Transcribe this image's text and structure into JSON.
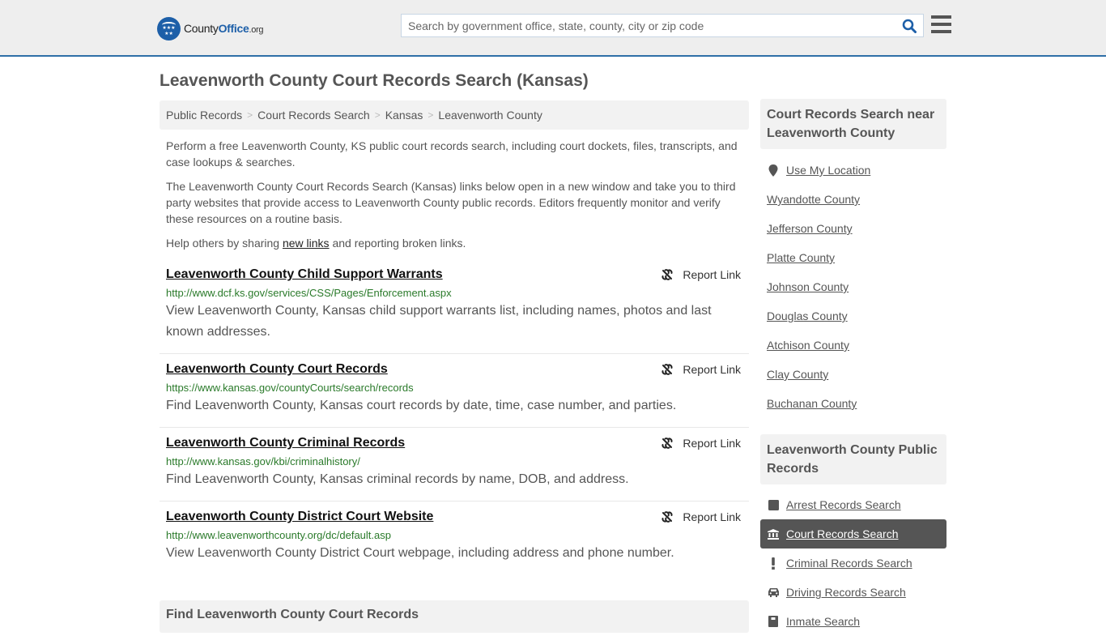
{
  "header": {
    "logo": {
      "county": "County",
      "office": "Office",
      "org": ".org"
    },
    "search": {
      "placeholder": "Search by government office, state, county, city or zip code",
      "value": ""
    },
    "icons": {
      "search": "search-icon",
      "menu": "hamburger-menu-icon"
    }
  },
  "page": {
    "title": "Leavenworth County Court Records Search (Kansas)"
  },
  "breadcrumb": [
    {
      "label": "Public Records"
    },
    {
      "label": "Court Records Search"
    },
    {
      "label": "Kansas"
    },
    {
      "label": "Leavenworth County"
    }
  ],
  "intro": {
    "p1": "Perform a free Leavenworth County, KS public court records search, including court dockets, files, transcripts, and case lookups & searches.",
    "p2": "The Leavenworth County Court Records Search (Kansas) links below open in a new window and take you to third party websites that provide access to Leavenworth County public records. Editors frequently monitor and verify these resources on a routine basis.",
    "p3_before": "Help others by sharing ",
    "p3_link": "new links",
    "p3_after": " and reporting broken links."
  },
  "links": [
    {
      "title": "Leavenworth County Child Support Warrants",
      "url": "http://www.dcf.ks.gov/services/CSS/Pages/Enforcement.aspx",
      "description": "View Leavenworth County, Kansas child support warrants list, including names, photos and last known addresses.",
      "report_label": "Report Link"
    },
    {
      "title": "Leavenworth County Court Records",
      "url": "https://www.kansas.gov/countyCourts/search/records",
      "description": "Find Leavenworth County, Kansas court records by date, time, case number, and parties.",
      "report_label": "Report Link"
    },
    {
      "title": "Leavenworth County Criminal Records",
      "url": "http://www.kansas.gov/kbi/criminalhistory/",
      "description": "Find Leavenworth County, Kansas criminal records by name, DOB, and address.",
      "report_label": "Report Link"
    },
    {
      "title": "Leavenworth County District Court Website",
      "url": "http://www.leavenworthcounty.org/dc/default.asp",
      "description": "View Leavenworth County District Court webpage, including address and phone number.",
      "report_label": "Report Link"
    }
  ],
  "find_section": {
    "title": "Find Leavenworth County Court Records"
  },
  "sidebar": {
    "nearby": {
      "title": "Court Records Search near Leavenworth County",
      "use_location": "Use My Location",
      "counties": [
        "Wyandotte County",
        "Jefferson County",
        "Platte County",
        "Johnson County",
        "Douglas County",
        "Atchison County",
        "Clay County",
        "Buchanan County"
      ]
    },
    "public_records": {
      "title": "Leavenworth County Public Records",
      "items": [
        {
          "label": "Arrest Records Search",
          "icon": "square-icon",
          "active": false
        },
        {
          "label": "Court Records Search",
          "icon": "courthouse-icon",
          "active": true
        },
        {
          "label": "Criminal Records Search",
          "icon": "exclamation-icon",
          "active": false
        },
        {
          "label": "Driving Records Search",
          "icon": "car-icon",
          "active": false
        },
        {
          "label": "Inmate Search",
          "icon": "inmate-icon",
          "active": false
        }
      ]
    }
  },
  "colors": {
    "brand_blue": "#1d5fa8",
    "header_border": "#2e6fa7",
    "url_green": "#2a7a2a",
    "active_bg": "#555555"
  }
}
